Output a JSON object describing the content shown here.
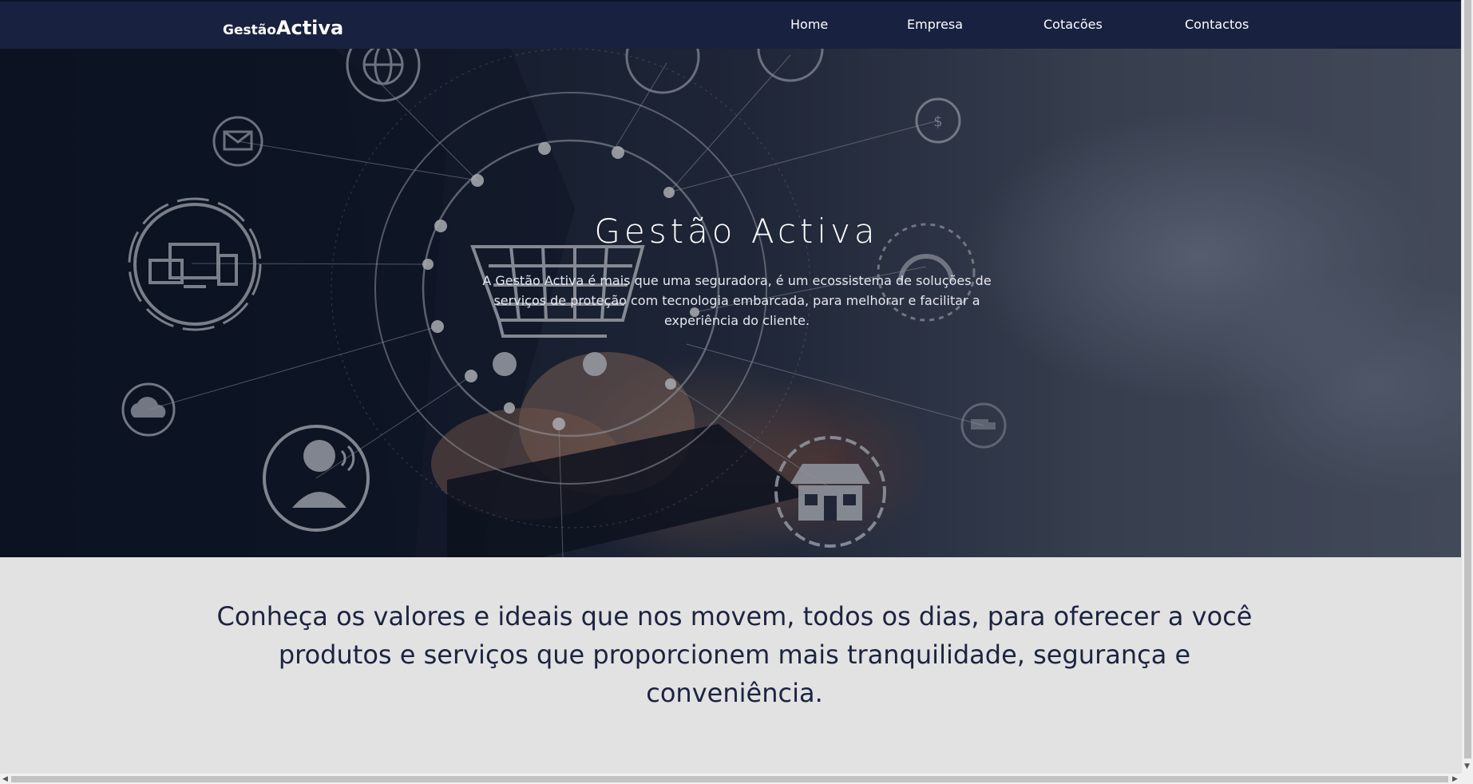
{
  "navbar": {
    "brand_small": "Gestão",
    "brand_large": "Activa",
    "links": [
      "Home",
      "Empresa",
      "Cotacões",
      "Contactos"
    ]
  },
  "hero": {
    "title": "Gestão Activa",
    "text": "A Gestão Activa é mais que uma seguradora, é um ecossistema de soluções de serviços de proteção com tecnologia embarcada, para melhorar e facilitar a experiência do cliente."
  },
  "values": {
    "text": "Conheça os valores e ideais que nos movem, todos os dias, para oferecer a você produtos e serviços que proporcionem mais tranquilidade, segurança e conveniência."
  },
  "colors": {
    "navbar_bg": "#18213f",
    "section_bg": "#e2e2e2",
    "values_text": "#1c2440"
  },
  "icons": [
    "globe-icon",
    "mail-icon",
    "devices-icon",
    "cloud-icon",
    "support-agent-icon",
    "shopping-cart-icon",
    "headphones-icon",
    "money-icon",
    "truck-icon",
    "store-icon"
  ]
}
